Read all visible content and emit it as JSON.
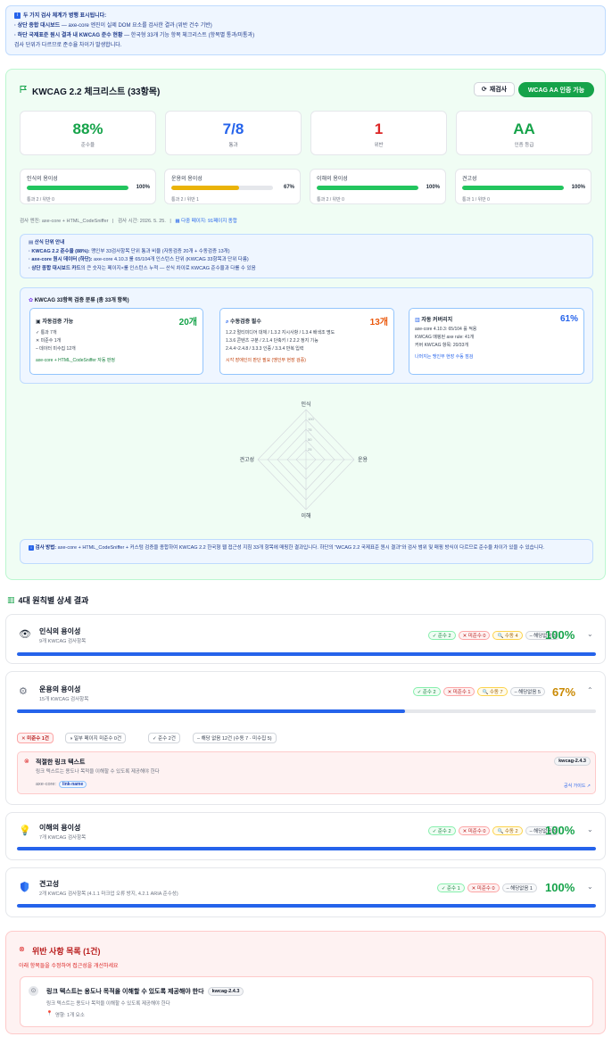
{
  "info": {
    "line1": "두 가지 검사 체계가 병행 표시됩니다:",
    "line2_bold": "· 상단 종합 대시보드",
    "line2_rest": " — axe-core 엔진이 실제 DOM 요소를 검사한 결과 (위반 건수 기반)",
    "line3_bold": "· 하단 국제표준 원시 결과 내 KWCAG 준수 현황",
    "line3_rest": " — 한국형 33개 기능 항목 체크리스트 (항목별 통과/미통과)",
    "line4": "검사 단위가 다르므로 준수율 차이가 발생합니다."
  },
  "header": {
    "title": "KWCAG 2.2 체크리스트 (33항목)",
    "rescan": "재검사",
    "cert": "WCAG AA 인증 가능"
  },
  "stats": [
    {
      "value": "88%",
      "label": "준수율",
      "color": "#16a34a"
    },
    {
      "value": "7/8",
      "label": "통과",
      "color": "#2563eb"
    },
    {
      "value": "1",
      "label": "위반",
      "color": "#dc2626"
    },
    {
      "value": "AA",
      "label": "인증 등급",
      "color": "#16a34a"
    }
  ],
  "principles": [
    {
      "name": "인식의 용이성",
      "pct": "100%",
      "fill": 1.0,
      "color": "#22c55e",
      "sub": "통과 2 / 위반 0"
    },
    {
      "name": "운용의 용이성",
      "pct": "67%",
      "fill": 0.67,
      "color": "#eab308",
      "sub": "통과 2 / 위반 1"
    },
    {
      "name": "이해의 용이성",
      "pct": "100%",
      "fill": 1.0,
      "color": "#22c55e",
      "sub": "통과 2 / 위반 0"
    },
    {
      "name": "견고성",
      "pct": "100%",
      "fill": 1.0,
      "color": "#22c55e",
      "sub": "통과 1 / 위반 0"
    }
  ],
  "meta": {
    "engine": "검사 엔진: axe-core + HTML_CodeSniffer",
    "time": "검사 시간: 2026. 5. 25.",
    "pages": "다중 페이지: 91페이지 종합"
  },
  "unit": {
    "title": "산식 단위 안내",
    "l1_bold": "· KWCAG 2.2 준수율 (88%):",
    "l1_rest": " 맹인부 33검사항목 단위 통과 비율 (자동검증 20개 + 수동검증 13개)",
    "l2_bold": "· axe-core 원시 데이터 (하단):",
    "l2_rest": " axe-core 4.10.3 룰 65/104개 인스턴스 단위 (KWCAG 33항목과 단위 다름)",
    "l3_bold": "· 상단 종합 대시보드 카드",
    "l3_rest": "의 큰 숫자는 페이지×룰 인스턴스 누적 — 산식 차이로 KWCAG 준수율과 다를 수 있음"
  },
  "breakdown": {
    "title": "KWCAG 33항목 검증 분류 (총 33개 항목)",
    "auto": {
      "title": "자동검증 가능",
      "count": "20개",
      "l1": "✓ 통과 7개",
      "l2": "✕ 미준수 1개",
      "l3": "– 데이터 미수집 12개",
      "foot": "axe-core + HTML_CodeSniffer 자동 판정"
    },
    "manual": {
      "title": "수동검증 필수",
      "count": "13개",
      "l1": "1.2.2 멀티미디어 대체 / 1.3.2 지시사항 / 1.3.4 배색조 명도",
      "l2": "1.3.6 콘텐츠 구분 / 2.1.4 단축키 / 2.2.2 정지 기능",
      "l3": "2.4.4~2.4.8 / 3.3.3 인증 / 3.3.4 반복 입력",
      "foot": "시각 장애인의 판단 필요 (맹인부 현장 검증)"
    },
    "coverage": {
      "title": "자동 커버리지",
      "count": "61%",
      "l1": "axe-core 4.10.3: 65/104 룰 적용",
      "l2": "KWCAG 매핑된 axe rule: 41개",
      "l3": "커버 KWCAG 항목: 20/33개",
      "foot": "나머지는 맹인부 현장 수동 점검"
    }
  },
  "radar": {
    "labels": [
      "인식",
      "운용",
      "이해",
      "견고성"
    ]
  },
  "method": {
    "bold": "검사 방법:",
    "text": " axe-core + HTML_CodeSniffer + 커스텀 검증을 종합하여 KWCAG 2.2 한국형 웹 접근성 지침 33개 항목에 매핑한 결과입니다. 하단의 \"WCAG 2.2 국제표준 원시 결과\"와 검사 범위 및 매핑 방식이 다르므로 준수율 차이가 있을 수 있습니다."
  },
  "detail": {
    "heading": "4대 원칙별 상세 결과",
    "sections": [
      {
        "name": "인식의 용이성",
        "sub": "9개 KWCAG 검사항목",
        "pass": "✓ 준수 2",
        "fail": "✕ 미준수 0",
        "manual": "🔍 수동 4",
        "na": "– 해당없음 3",
        "pct": "100%",
        "fill": 1.0,
        "pctColor": "#16a34a"
      },
      {
        "name": "운용의 용이성",
        "sub": "15개 KWCAG 검사항목",
        "pass": "✓ 준수 2",
        "fail": "✕ 미준수 1",
        "manual": "🔍 수동 7",
        "na": "– 해당없음 5",
        "pct": "67%",
        "fill": 0.67,
        "pctColor": "#ca8a04"
      },
      {
        "name": "이해의 용이성",
        "sub": "7개 KWCAG 검사항목",
        "pass": "✓ 준수 2",
        "fail": "✕ 미준수 0",
        "manual": "🔍 수동 2",
        "na": "– 해당없음 3",
        "pct": "100%",
        "fill": 1.0,
        "pctColor": "#16a34a"
      },
      {
        "name": "견고성",
        "sub": "2개 KWCAG 검사항목 (4.1.1 마크업 오류 방지, 4.2.1 ARIA 준수성)",
        "pass": "✓ 준수 1",
        "fail": "✕ 미준수 0",
        "na": "– 해당없음 1",
        "pct": "100%",
        "fill": 1.0,
        "pctColor": "#16a34a"
      }
    ],
    "tabs": [
      "✕ 미준수 1건",
      "◑ 일부 페이지 미준수 0건",
      "✓ 준수 2건",
      "– 해당 없음 12건 (수동 7 · 미수집 5)"
    ],
    "item": {
      "title": "적절한 링크 텍스트",
      "desc": "링크 텍스트는 용도나 목적을 이해할 수 있도록 제공해야 한다",
      "axe": "axe-core:",
      "rule": "link-name",
      "code": "kwcag-2.4.3",
      "guide": "공식 가이드 ↗"
    }
  },
  "violations": {
    "title": "위반 사항 목록 (1건)",
    "sub": "아래 항목들을 수정하여 접근성을 개선하세요",
    "item_title": "링크 텍스트는 용도나 목적을 이해할 수 있도록 제공해야 한다",
    "item_code": "kwcag-2.4.3",
    "item_desc": "링크 텍스트는 용도나 목적을 이해할 수 있도록 제공해야 한다",
    "item_loc": "영향: 1개 요소"
  }
}
